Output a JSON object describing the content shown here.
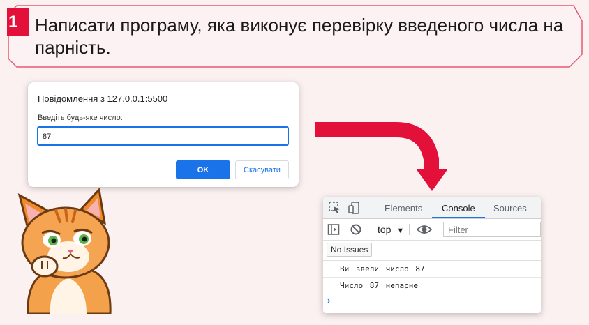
{
  "task": {
    "number": "1",
    "text": "Написати програму, яка виконує перевірку введеного числа на парність."
  },
  "dialog": {
    "title": "Повідомлення з 127.0.0.1:5500",
    "message": "Введіть будь-яке число:",
    "input_value": "87",
    "ok_label": "OK",
    "cancel_label": "Скасувати"
  },
  "devtools": {
    "tabs": [
      "Elements",
      "Console",
      "Sources"
    ],
    "active_tab": "Console",
    "context": "top",
    "filter_placeholder": "Filter",
    "issues_label": "No Issues",
    "console_lines": [
      "Ви ввели число 87",
      "Число 87 непарне"
    ],
    "prompt_symbol": "›"
  },
  "colors": {
    "accent_red": "#e3103a",
    "banner_border": "#e8596f",
    "button_blue": "#1a73e8",
    "background": "#fcf1f1"
  },
  "icons": [
    "inspect-icon",
    "device-toggle-icon",
    "sidebar-toggle-icon",
    "clear-console-icon",
    "eye-icon",
    "curved-arrow-icon",
    "cat-illustration"
  ]
}
